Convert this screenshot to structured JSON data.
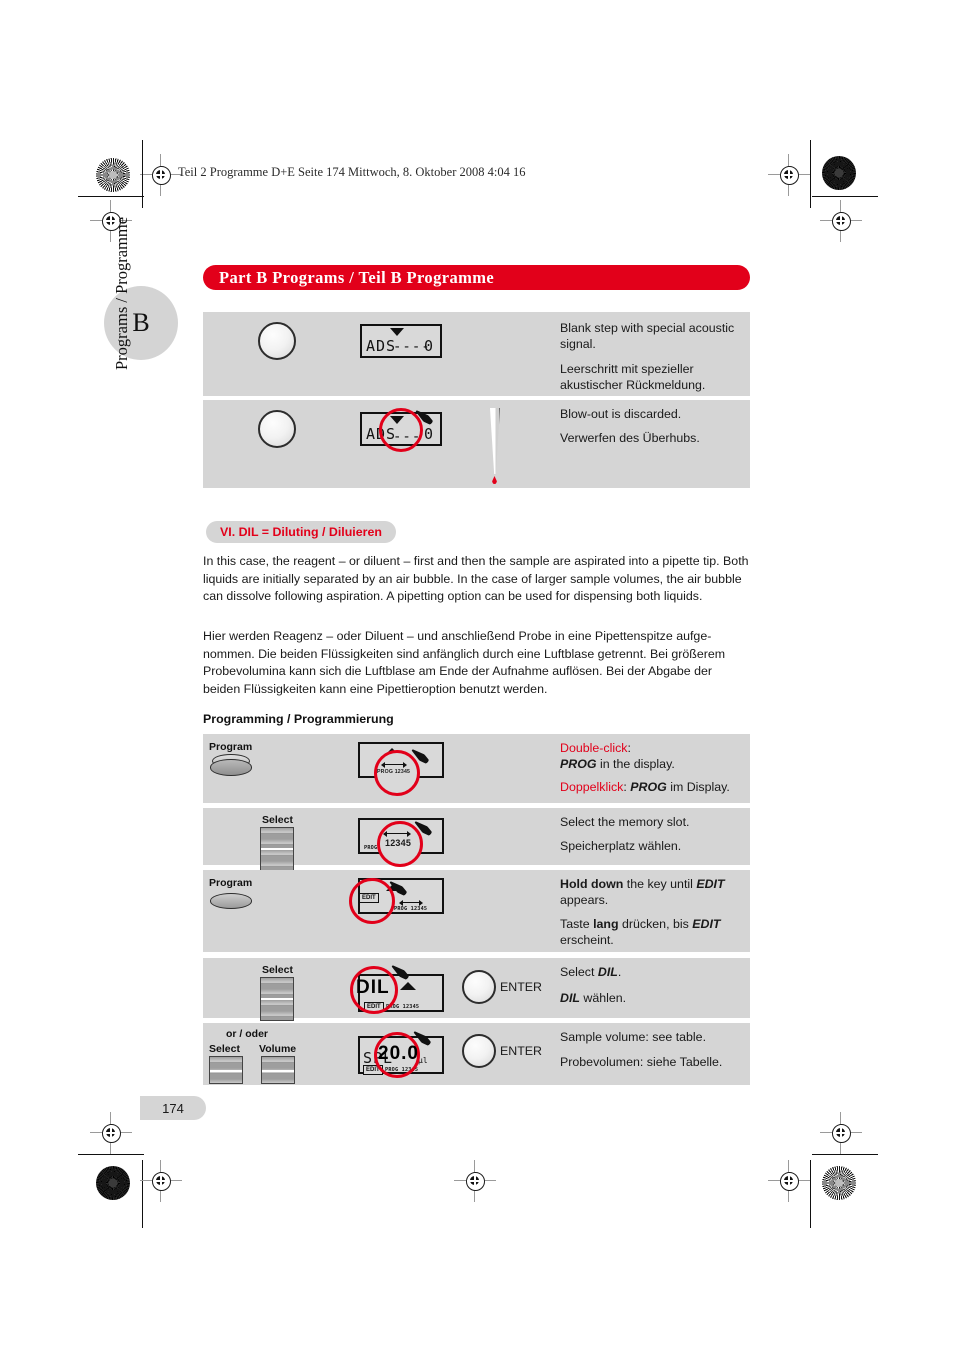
{
  "print_header": "Teil 2 Programme D+E  Seite 174  Mittwoch, 8. Oktober 2008  4:04 16",
  "banner": {
    "title": "Part B  Programs / Teil B  Programme"
  },
  "side_tab": {
    "letter": "B",
    "vertical_label": "Programs / Programme"
  },
  "footer": {
    "page_number": "174"
  },
  "colors": {
    "accent_red": "#e2001a",
    "panel_gray": "#d5d5d5",
    "lcd_gray": "#d9d9d9"
  },
  "top_steps": [
    {
      "lcd": {
        "mode": "ADS",
        "dashes": "----",
        "value": "0"
      },
      "text_en": "Blank step with special acoustic signal.",
      "text_de": "Leerschritt mit spezieller akustischer Rückmeldung."
    },
    {
      "lcd": {
        "mode": "ADS",
        "dashes": "---",
        "value": "0"
      },
      "text_en": "Blow-out is discarded.",
      "text_de": "Verwerfen des Überhubs."
    }
  ],
  "section": {
    "label": "VI.  DIL = Diluting / Diluieren"
  },
  "paragraph_en": "In this case, the reagent – or diluent – first and then the sample are aspirated into a pipette tip. Both liquids are initially separated by an air bubble. In the case of larger sample volumes, the air bubble can dissolve following aspiration. A pipetting option can be used for dispensing both liquids.",
  "paragraph_de": "Hier werden Reagenz – oder Diluent – und anschließend Probe in eine Pipettenspitze aufge-nommen. Die beiden Flüssigkeiten sind anfänglich durch eine Luftblase getrennt. Bei größerem Probevolumina kann sich die Luftblase am Ende der Aufnahme auflösen. Bei der Abgabe der beiden Flüssigkeiten kann eine Pipettieroption benutzt werden.",
  "programming_heading": "Programming / Programmierung",
  "programming_rows": [
    {
      "key_label": "Program",
      "lcd": {
        "prog_label": "PROG 12345"
      },
      "instr_en_lead": "Double-click",
      "instr_en_rest": ":",
      "instr_en_line2_bold": "PROG",
      "instr_en_line2_rest": " in the display.",
      "instr_de_lead": "Doppelklick",
      "instr_de_rest": ": ",
      "instr_de_bold": "PROG",
      "instr_de_tail": " im Display."
    },
    {
      "key_label": "Select",
      "lcd": {
        "prog_label": "PROG",
        "digits": "12345"
      },
      "instr_en": "Select the memory slot.",
      "instr_de": "Speicherplatz wählen."
    },
    {
      "key_label": "Program",
      "lcd": {
        "edit_label": "EDIT",
        "prog_label": "PROG 12345"
      },
      "instr_en_bold": "Hold down",
      "instr_en_mid": " the key until ",
      "instr_en_bi": "EDIT",
      "instr_en_line2": "appears.",
      "instr_de_pre": "Taste ",
      "instr_de_bold": "lang",
      "instr_de_mid": " drücken, bis ",
      "instr_de_bi": "EDIT",
      "instr_de_line2": "erscheint."
    },
    {
      "key_label": "Select",
      "lcd": {
        "mode": "DIL",
        "edit_label": "EDIT",
        "prog_label": "PROG 12345"
      },
      "enter_label": "ENTER",
      "instr_en_pre": "Select ",
      "instr_en_bi": "DIL",
      "instr_en_tail": ".",
      "instr_de_bi": "DIL",
      "instr_de_tail": " wählen."
    },
    {
      "or_label": "or / oder",
      "key_label_left": "Select",
      "key_label_right": "Volume",
      "lcd": {
        "mode": "SPL",
        "value": "20.0",
        "unit": "µl",
        "edit_label": "EDIT",
        "prog_label": "PROG 12345"
      },
      "enter_label": "ENTER",
      "instr_en": "Sample volume: see table.",
      "instr_de": "Probevolumen: siehe Tabelle."
    }
  ]
}
